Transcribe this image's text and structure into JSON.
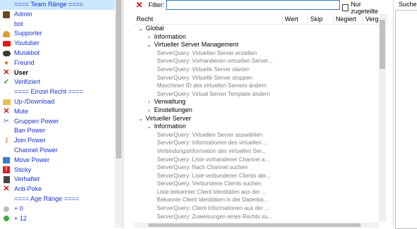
{
  "groups": [
    {
      "label": "==== Team Ränge ====",
      "icon": "none",
      "style": "blue",
      "selected": true
    },
    {
      "label": "Admin",
      "icon": "admin-avatar-icon",
      "style": "blue"
    },
    {
      "label": "bot",
      "icon": "none",
      "style": "blue"
    },
    {
      "label": "Supporter",
      "icon": "supporter-icon",
      "style": "blue"
    },
    {
      "label": "Youtuber",
      "icon": "youtube-icon",
      "style": "blue"
    },
    {
      "label": "Musikbot",
      "icon": "music-bot-icon",
      "style": "blue"
    },
    {
      "label": "Freund",
      "icon": "paw-icon",
      "style": "blue"
    },
    {
      "label": "User",
      "icon": "red-x-icon",
      "style": "black"
    },
    {
      "label": "Verifiziert",
      "icon": "checkmark-icon",
      "style": "blue"
    },
    {
      "label": "==== Einzel Recht ====",
      "icon": "none",
      "style": "blue"
    },
    {
      "label": "Up-/Download",
      "icon": "folder-icon",
      "style": "blue"
    },
    {
      "label": "Mute",
      "icon": "red-x-icon",
      "style": "blue"
    },
    {
      "label": "Gruppen Power",
      "icon": "tools-icon",
      "style": "blue"
    },
    {
      "label": "Ban Power",
      "icon": "none",
      "style": "blue"
    },
    {
      "label": "Join Power",
      "icon": "key-icon",
      "style": "blue"
    },
    {
      "label": "Channel Power",
      "icon": "none",
      "style": "blue"
    },
    {
      "label": "Move Power",
      "icon": "move-icon",
      "style": "blue"
    },
    {
      "label": "Sticky",
      "icon": "exclamation-icon",
      "style": "blue"
    },
    {
      "label": "Verhaftet",
      "icon": "jail-icon",
      "style": "blue"
    },
    {
      "label": "Anti-Poke",
      "icon": "red-x-icon",
      "style": "blue"
    },
    {
      "label": "==== Age Ränge ====",
      "icon": "none",
      "style": "blue"
    },
    {
      "label": "+ 0",
      "icon": "circle-grey-icon",
      "style": "blue"
    },
    {
      "label": "+ 12",
      "icon": "circle-green-icon",
      "style": "blue"
    }
  ],
  "filter": {
    "label": "Filter:",
    "value": "",
    "only_assigned": "Nur zugeteilte"
  },
  "columns": [
    "Recht",
    "Wert",
    "Skip",
    "Negiert",
    "Vergab"
  ],
  "tree": [
    {
      "text": "Global",
      "level": 0,
      "arrow": "open"
    },
    {
      "text": "Information",
      "level": 1,
      "arrow": "closed"
    },
    {
      "text": "Virtueller Server Management",
      "level": 1,
      "arrow": "open"
    },
    {
      "text": "ServerQuery: Virtuellen Server erstellen",
      "level": 2,
      "perm": true
    },
    {
      "text": "ServerQuery: Vorhandenen virtuellen Server...",
      "level": 2,
      "perm": true
    },
    {
      "text": "ServerQuery: Virtuelle Server starten",
      "level": 2,
      "perm": true
    },
    {
      "text": "ServerQuery: Virtuelle Server stoppen",
      "level": 2,
      "perm": true
    },
    {
      "text": "Maschinen ID des virtuellen Servers ändern",
      "level": 2,
      "perm": true
    },
    {
      "text": "ServerQuery: Virtual Server Template ändern",
      "level": 2,
      "perm": true
    },
    {
      "text": "Verwaltung",
      "level": 1,
      "arrow": "closed"
    },
    {
      "text": "Einstellungen",
      "level": 1,
      "arrow": "closed"
    },
    {
      "text": "Virtueller Server",
      "level": 0,
      "arrow": "open"
    },
    {
      "text": "Information",
      "level": 1,
      "arrow": "open"
    },
    {
      "text": "ServerQuery: Virtuellen Server auswählen",
      "level": 2,
      "perm": true
    },
    {
      "text": "ServerQuery: Informationen des virtuellen ...",
      "level": 2,
      "perm": true
    },
    {
      "text": "Verbindungsinformation des virtuellen Ser...",
      "level": 2,
      "perm": true
    },
    {
      "text": "ServerQuery: Liste vorhandener Channel a...",
      "level": 2,
      "perm": true
    },
    {
      "text": "ServerQuery: Nach Channel suchen",
      "level": 2,
      "perm": true
    },
    {
      "text": "ServerQuery: Liste verbundener Clients abr...",
      "level": 2,
      "perm": true
    },
    {
      "text": "ServerQuery: Verbundene Clients suchen",
      "level": 2,
      "perm": true
    },
    {
      "text": "Liste bekannter Client Identitäten aus der ...",
      "level": 2,
      "perm": true
    },
    {
      "text": "Bekannte Client Identitäten in der Datenba...",
      "level": 2,
      "perm": true
    },
    {
      "text": "ServerQuery: Client Informationen aus der ...",
      "level": 2,
      "perm": true
    },
    {
      "text": "ServerQuery: Zuweisungen eines Rechts su...",
      "level": 2,
      "perm": true
    }
  ],
  "search": {
    "label": "Suchen:"
  }
}
